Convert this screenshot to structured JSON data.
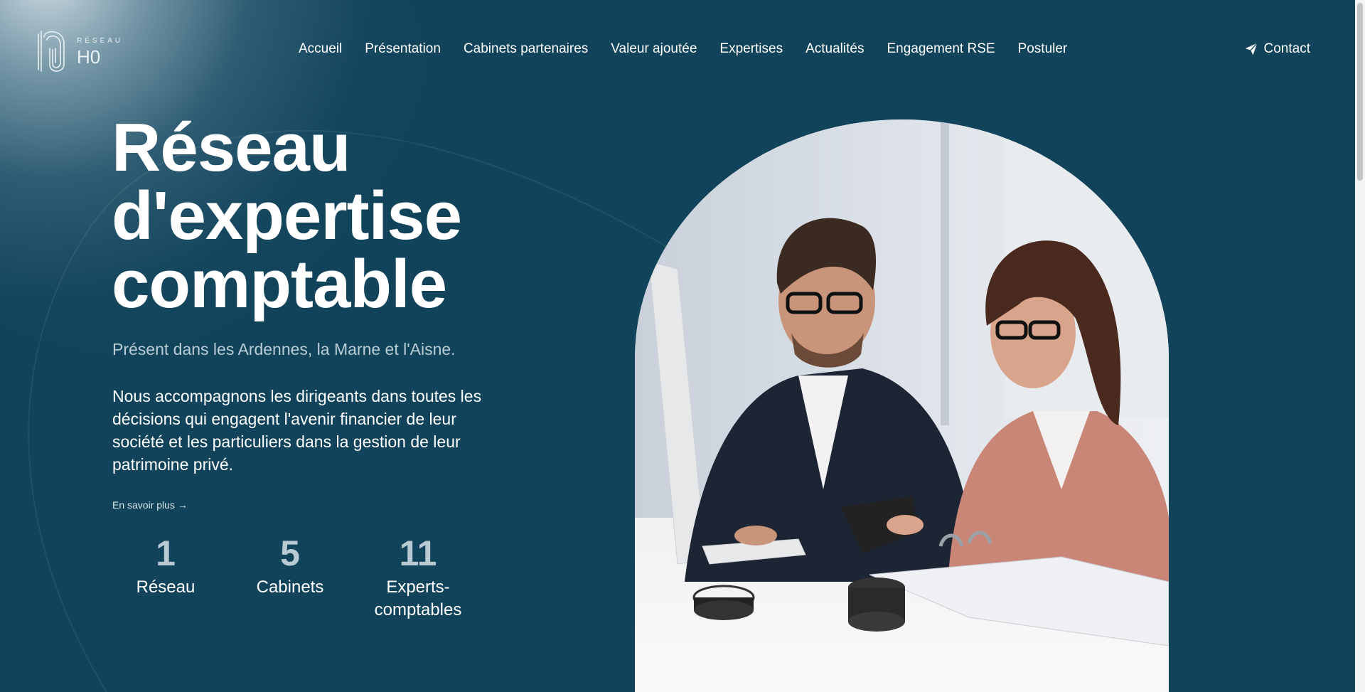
{
  "logo": {
    "small_text": "RÉSEAU",
    "big_text": "H0"
  },
  "nav": {
    "items": [
      {
        "label": "Accueil"
      },
      {
        "label": "Présentation"
      },
      {
        "label": "Cabinets partenaires"
      },
      {
        "label": "Valeur ajoutée"
      },
      {
        "label": "Expertises"
      },
      {
        "label": "Actualités"
      },
      {
        "label": "Engagement RSE"
      },
      {
        "label": "Postuler"
      }
    ],
    "contact_label": "Contact",
    "contact_icon": "paper-plane-icon"
  },
  "hero": {
    "title_lines": [
      "Réseau",
      "d'expertise",
      "comptable"
    ],
    "subtitle": "Présent dans les Ardennes, la Marne et l'Aisne.",
    "description": "Nous accompagnons les dirigeants dans toutes les décisions qui engagent l'avenir financier de leur société et les particuliers dans la gestion de leur patrimoine privé.",
    "more_link": "En savoir plus →"
  },
  "stats": [
    {
      "value": "1",
      "label": "Réseau"
    },
    {
      "value": "5",
      "label": "Cabinets"
    },
    {
      "value": "11",
      "label": "Experts-comptables"
    }
  ],
  "colors": {
    "background": "#11435a",
    "accent_light": "#b7cad3",
    "text": "#ffffff"
  }
}
